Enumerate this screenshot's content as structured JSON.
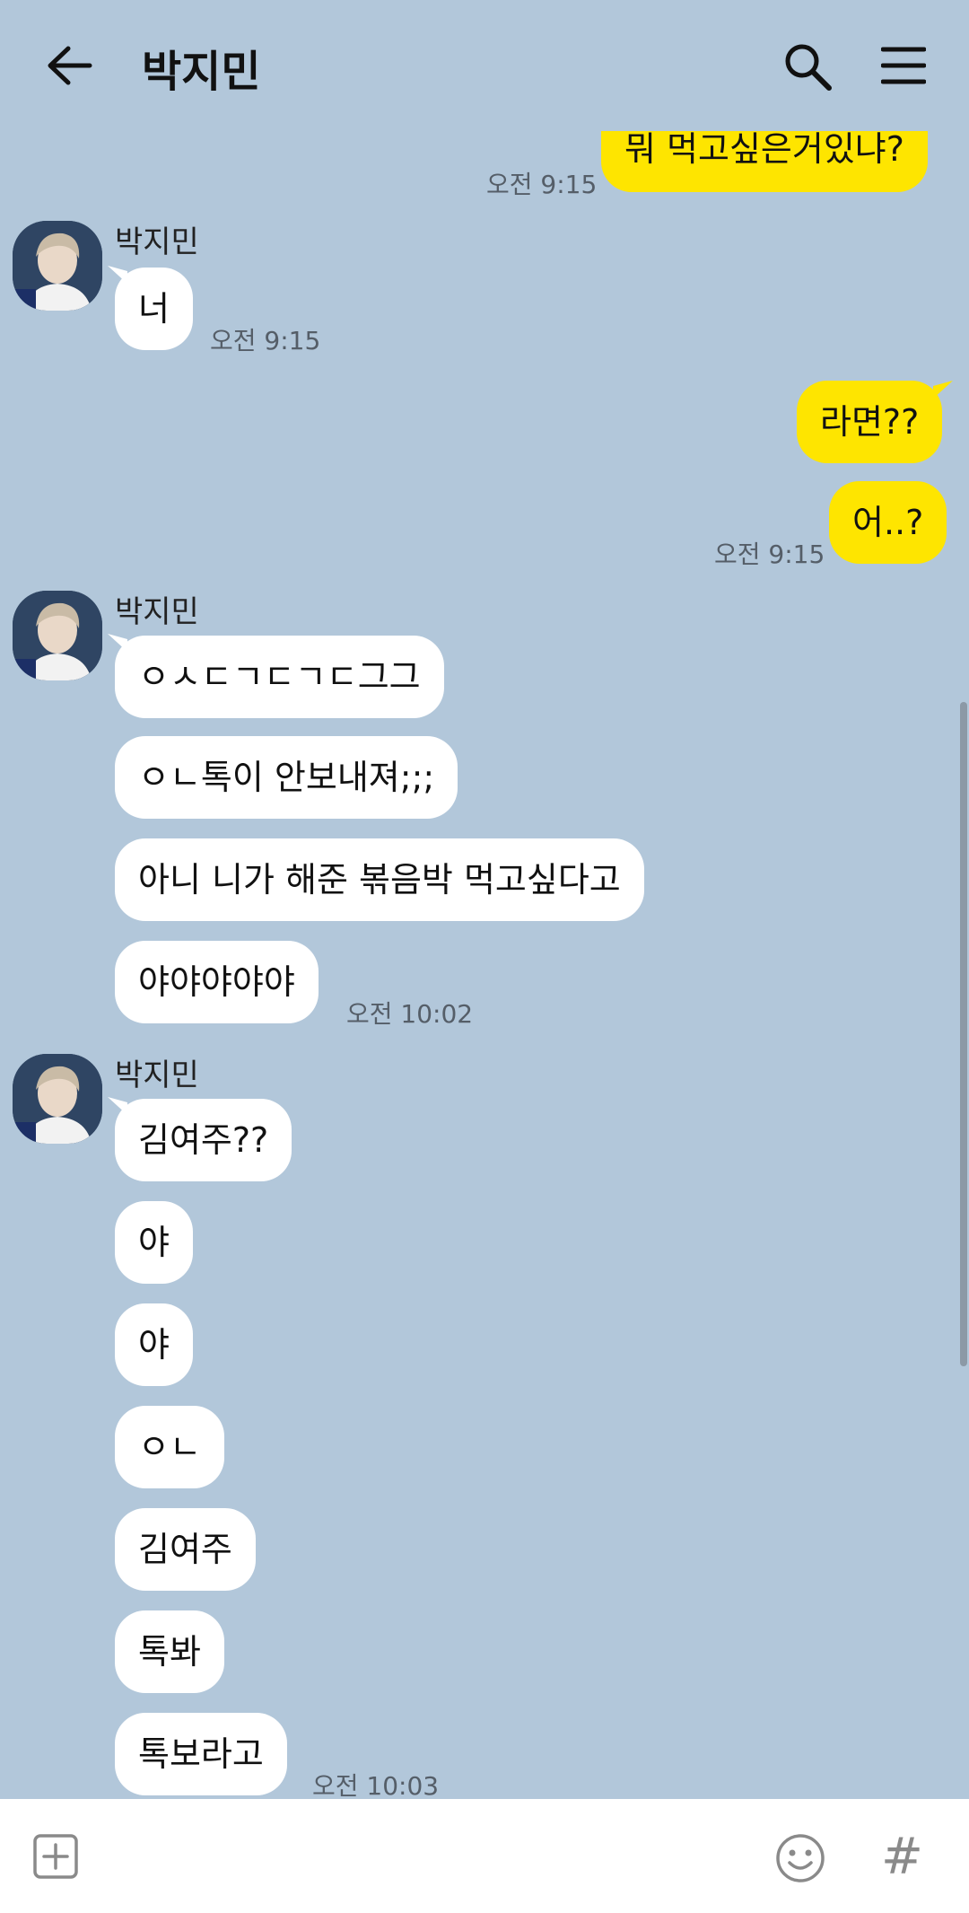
{
  "header": {
    "title": "박지민"
  },
  "messages": {
    "m1": {
      "text": "뭐 먹고싶은거있냐?",
      "time": "오전 9:15"
    },
    "g1": {
      "sender": "박지민",
      "m1": "너",
      "time": "오전 9:15"
    },
    "m2": {
      "text": "라면??"
    },
    "m3": {
      "text": "어..?",
      "time": "오전 9:15"
    },
    "g2": {
      "sender": "박지민",
      "m1": "ㅇㅅㄷㄱㄷㄱㄷ그그",
      "m2": "ㅇㄴ톡이 안보내져;;;",
      "m3": "아니 니가 해준 볶음박 먹고싶다고",
      "m4": "야야야야야",
      "time": "오전 10:02"
    },
    "g3": {
      "sender": "박지민",
      "m1": "김여주??",
      "m2": "야",
      "m3": "야",
      "m4": "ㅇㄴ",
      "m5": "김여주",
      "m6": "톡봐",
      "m7": "톡보라고",
      "time": "오전 10:03"
    }
  },
  "icons": {
    "back": "arrow-left-icon",
    "search": "search-icon",
    "menu": "hamburger-menu-icon",
    "attach": "plus-square-icon",
    "emoji": "emoji-icon",
    "hashtag": "hashtag-icon"
  },
  "colors": {
    "background": "#b2c7da",
    "outgoing": "#fee500",
    "incoming": "#ffffff"
  }
}
